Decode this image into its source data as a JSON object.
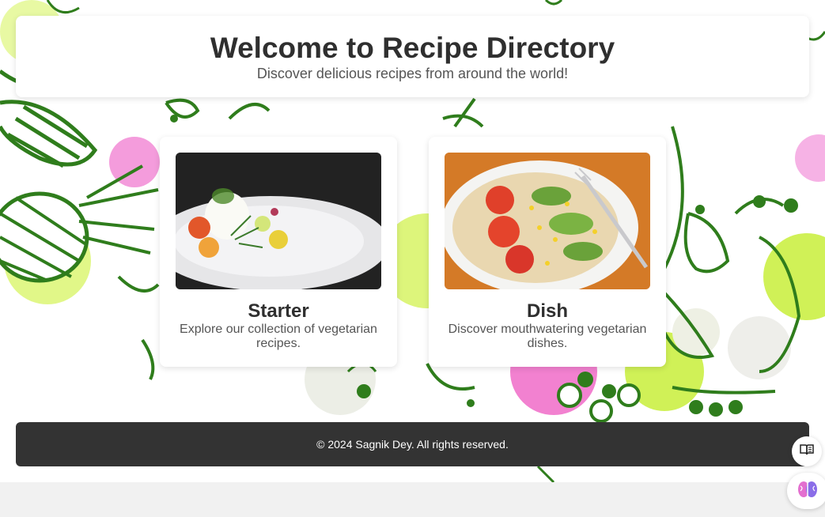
{
  "header": {
    "title": "Welcome to Recipe Directory",
    "subtitle": "Discover delicious recipes from around the world!"
  },
  "cards": [
    {
      "title": "Starter",
      "description": "Explore our collection of vegetarian recipes.",
      "image_alt": "plated burrata starter"
    },
    {
      "title": "Dish",
      "description": "Discover mouthwatering vegetarian dishes.",
      "image_alt": "avocado tomato flatbread dish"
    }
  ],
  "footer": {
    "text": "© 2024 Sagnik Dey. All rights reserved."
  },
  "floating_buttons": [
    {
      "icon": "reader-icon"
    },
    {
      "icon": "brain-icon"
    }
  ],
  "colors": {
    "footer_bg": "#333333",
    "pattern_green": "#2f7d1c",
    "pattern_lime": "#c8ef3a",
    "pattern_pink": "#f06bc8"
  }
}
